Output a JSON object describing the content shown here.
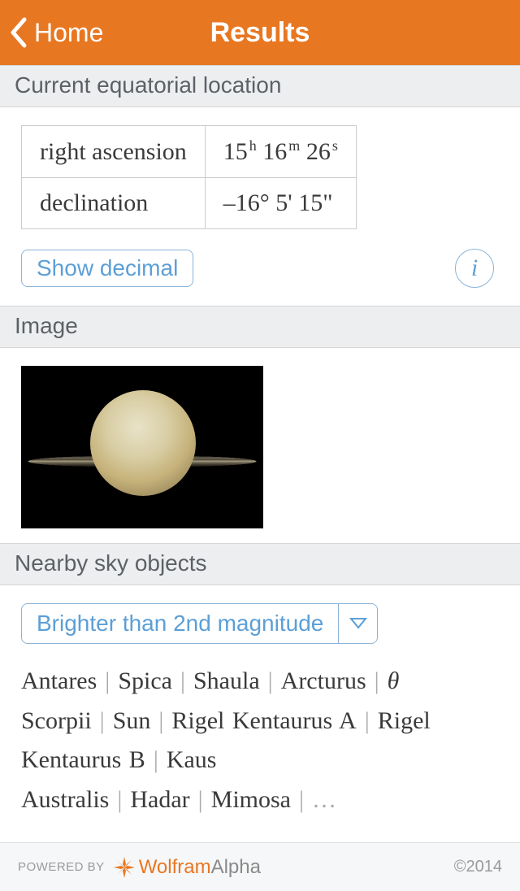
{
  "header": {
    "back_label": "Home",
    "title": "Results"
  },
  "sections": {
    "equatorial": {
      "title": "Current equatorial location",
      "rows": [
        {
          "label": "right ascension",
          "h": "15",
          "m": "16",
          "s": "26"
        },
        {
          "label": "declination",
          "value": "–16° 5' 15\""
        }
      ],
      "show_decimal_label": "Show decimal"
    },
    "image": {
      "title": "Image",
      "object": "Saturn"
    },
    "nearby": {
      "title": "Nearby sky objects",
      "filter_label": "Brighter than 2nd magnitude",
      "objects": [
        "Antares",
        "Spica",
        "Shaula",
        "Arcturus",
        "θ Scorpii",
        "Sun",
        "Rigel Kentaurus A",
        "Rigel Kentaurus B",
        "Kaus Australis",
        "Hadar",
        "Mimosa"
      ],
      "ellipsis": "…"
    }
  },
  "footer": {
    "powered_by": "POWERED BY",
    "brand_a": "Wolfram",
    "brand_b": "Alpha",
    "copyright": "©2014"
  },
  "colors": {
    "accent": "#e87722",
    "link": "#5c9fd6"
  }
}
